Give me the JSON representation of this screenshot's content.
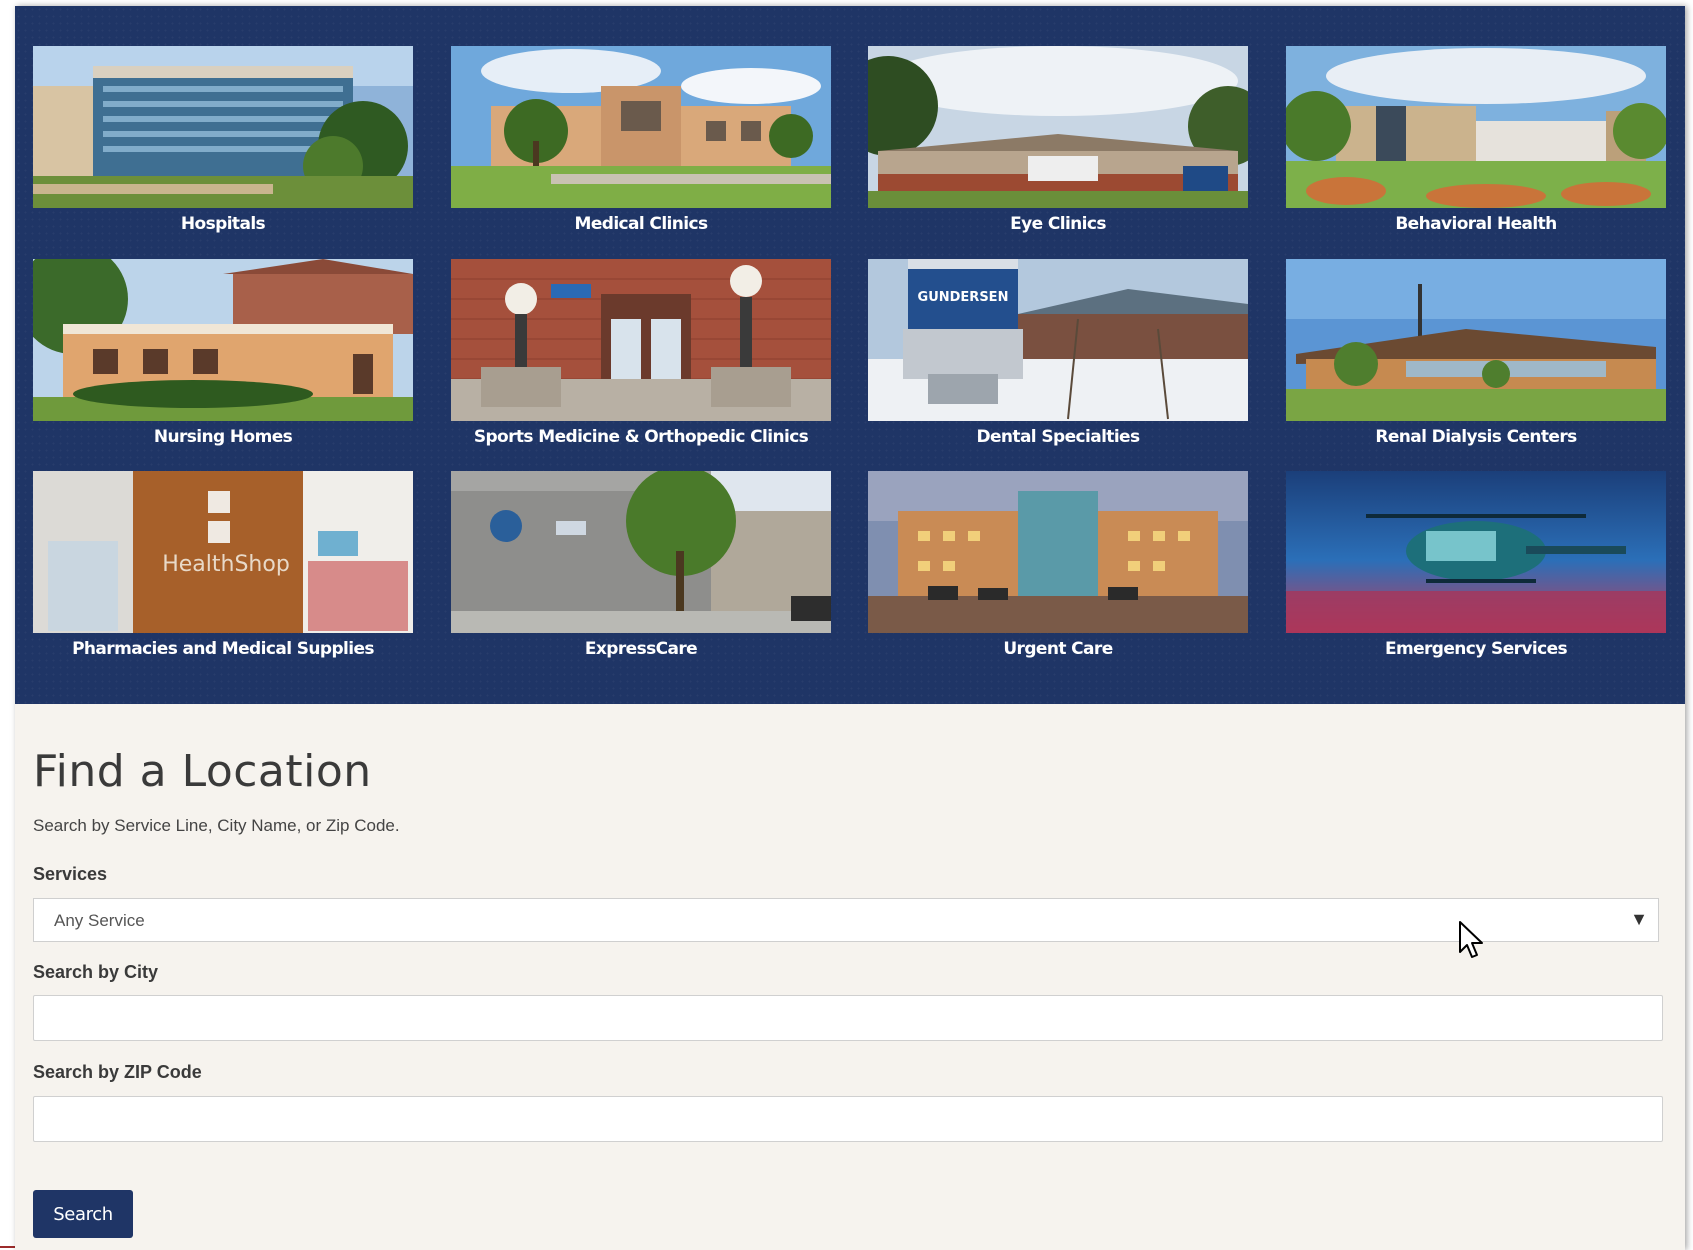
{
  "tiles": [
    {
      "label": "Hospitals"
    },
    {
      "label": "Medical Clinics"
    },
    {
      "label": "Eye Clinics"
    },
    {
      "label": "Behavioral Health"
    },
    {
      "label": "Nursing Homes"
    },
    {
      "label": "Sports Medicine & Orthopedic Clinics"
    },
    {
      "label": "Dental Specialties"
    },
    {
      "label": "Renal Dialysis Centers"
    },
    {
      "label": "Pharmacies and Medical Supplies"
    },
    {
      "label": "ExpressCare"
    },
    {
      "label": "Urgent Care"
    },
    {
      "label": "Emergency Services"
    }
  ],
  "photo_text": {
    "dental_sign": "GUNDERSEN",
    "pharmacy_sign": "HealthShop"
  },
  "find": {
    "title": "Find a Location",
    "subtitle": "Search by Service Line, City Name, or Zip Code.",
    "services_label": "Services",
    "services_value": "Any Service",
    "city_label": "Search by City",
    "city_value": "",
    "zip_label": "Search by ZIP Code",
    "zip_value": "",
    "search_button": "Search"
  },
  "colors": {
    "banner": "#1f3566",
    "button": "#1f3566",
    "page": "#f6f3ee"
  }
}
